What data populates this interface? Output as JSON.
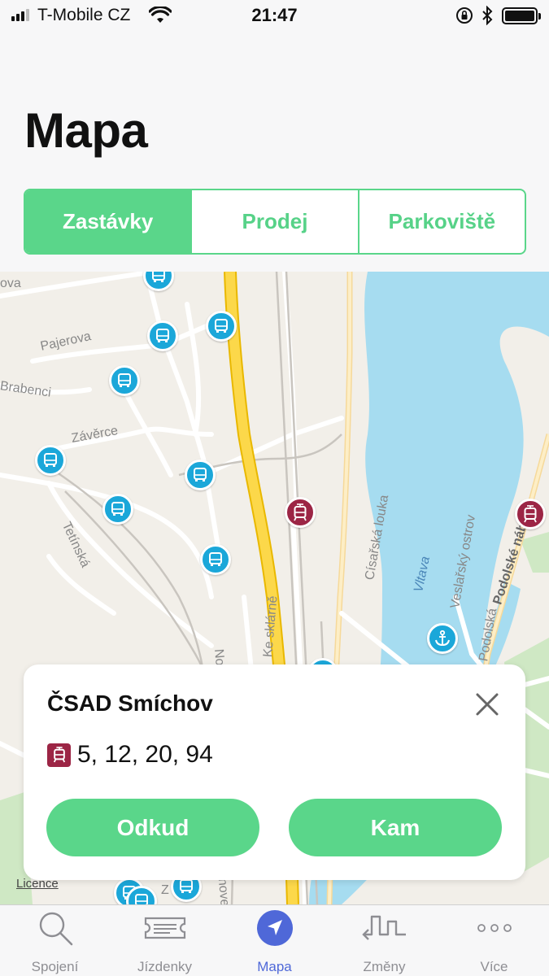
{
  "status_bar": {
    "carrier": "T-Mobile CZ",
    "time": "21:47"
  },
  "header": {
    "title": "Mapa"
  },
  "segmented": {
    "items": [
      {
        "label": "Zastávky",
        "active": true
      },
      {
        "label": "Prodej",
        "active": false
      },
      {
        "label": "Parkoviště",
        "active": false
      }
    ]
  },
  "map": {
    "labels": [
      "ova",
      "Pajerova",
      "Brabenci",
      "Závěrce",
      "Tetínská",
      "Nov",
      "Ke sklárně",
      "Císařská louka",
      "Vltava",
      "Veslařský ostrov",
      "Podolské nábř.",
      "Podolská",
      "ahove",
      "Z"
    ],
    "licence": "Licence"
  },
  "stop_card": {
    "name": "ČSAD Smíchov",
    "lines": "5, 12, 20, 94",
    "from_button": "Odkud",
    "to_button": "Kam"
  },
  "tabbar": {
    "items": [
      {
        "label": "Spojení",
        "icon": "search-icon"
      },
      {
        "label": "Jízdenky",
        "icon": "ticket-icon"
      },
      {
        "label": "Mapa",
        "icon": "location-arrow-icon",
        "active": true
      },
      {
        "label": "Změny",
        "icon": "changes-icon"
      },
      {
        "label": "Více",
        "icon": "more-icon"
      }
    ]
  },
  "colors": {
    "accent_green": "#5ad68a",
    "bus_blue": "#1ba7d9",
    "tram_red": "#9c2545",
    "tab_active": "#4f68d8",
    "water": "#a6dcf0"
  }
}
